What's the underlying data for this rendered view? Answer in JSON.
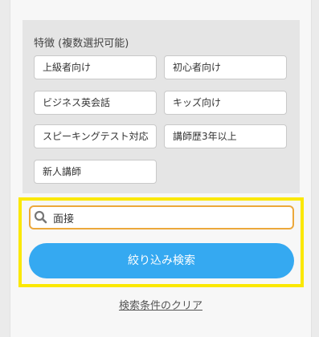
{
  "features": {
    "title": "特徴 (複数選択可能)",
    "options": [
      "上級者向け",
      "初心者向け",
      "ビジネス英会話",
      "キッズ向け",
      "スピーキングテスト対応",
      "講師歴3年以上",
      "新人講師"
    ]
  },
  "search": {
    "icon": "search-icon",
    "value": "面接"
  },
  "filter_button_label": "絞り込み検索",
  "clear_link_label": "検索条件のクリア",
  "colors": {
    "highlight_border": "#fbe800",
    "search_border": "#eca83b",
    "button_bg": "#35a9f1"
  }
}
